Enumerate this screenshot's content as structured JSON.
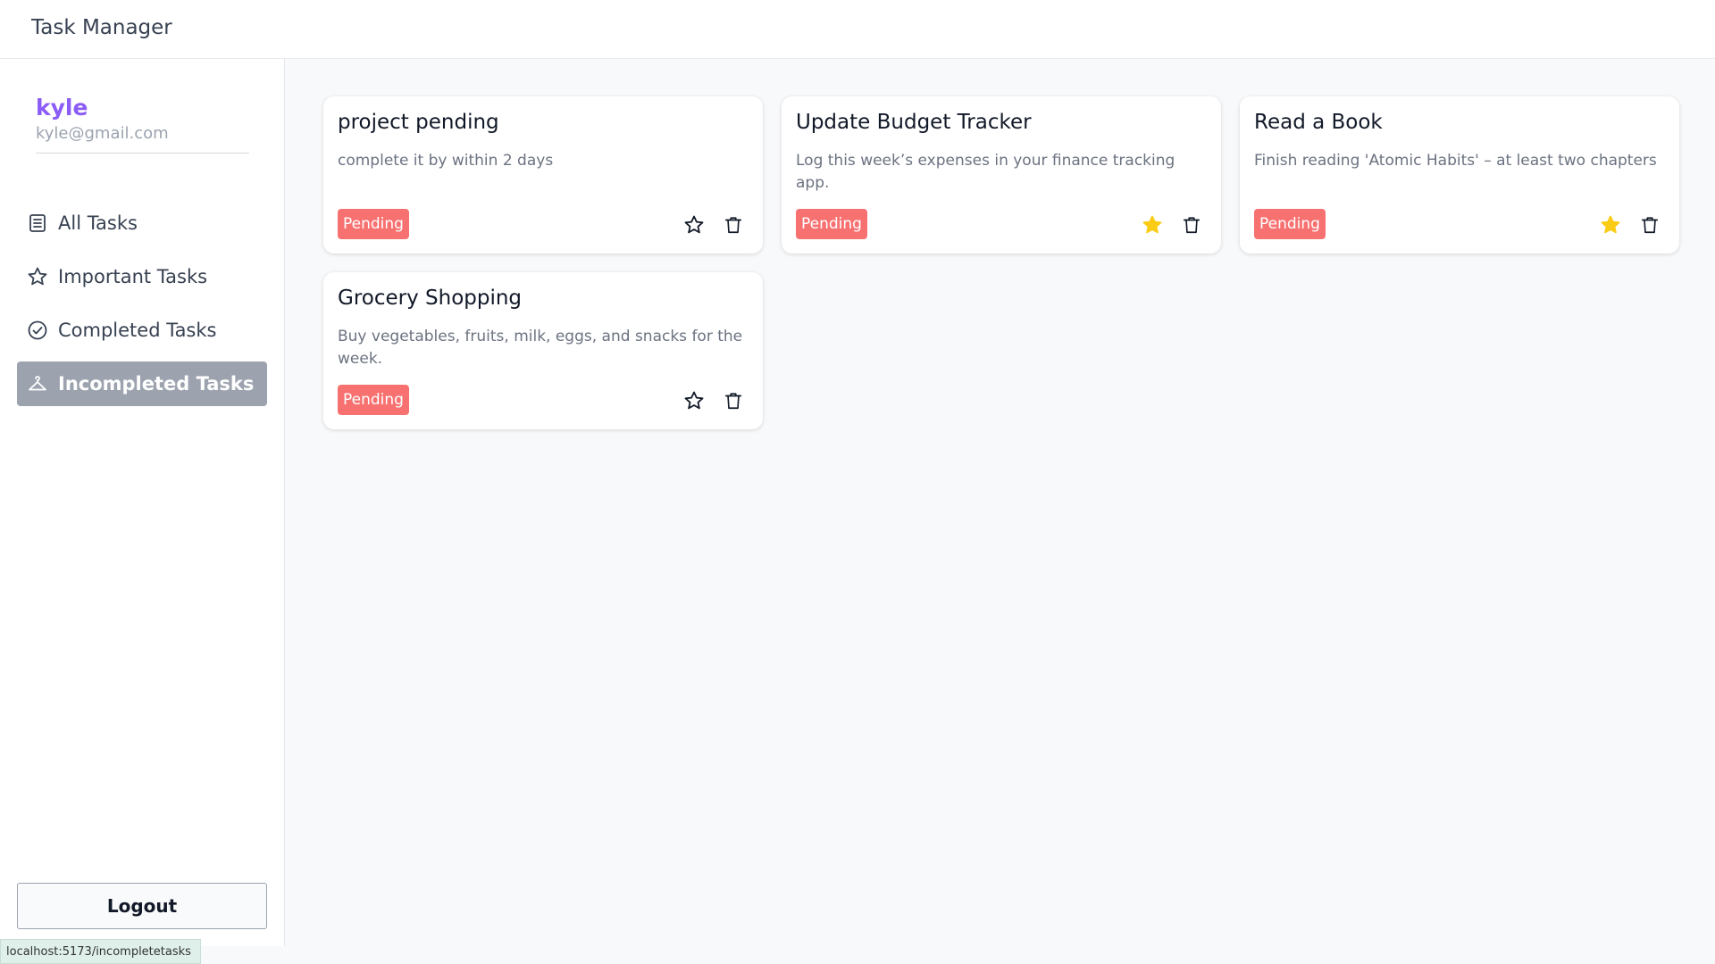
{
  "app": {
    "title": "Task Manager"
  },
  "user": {
    "name": "kyle",
    "email": "kyle@gmail.com"
  },
  "nav": {
    "items": [
      {
        "label": "All Tasks",
        "icon": "list-icon",
        "active": false
      },
      {
        "label": "Important Tasks",
        "icon": "star-icon",
        "active": false
      },
      {
        "label": "Completed Tasks",
        "icon": "check-circle-icon",
        "active": false
      },
      {
        "label": "Incompleted Tasks",
        "icon": "hanger-icon",
        "active": true
      }
    ],
    "logout_label": "Logout"
  },
  "tasks": [
    {
      "title": "project pending",
      "description": "complete it by within 2 days",
      "status": "Pending",
      "important": false
    },
    {
      "title": "Update Budget Tracker",
      "description": "Log this week’s expenses in your finance tracking app.",
      "status": "Pending",
      "important": true
    },
    {
      "title": "Read a Book",
      "description": "Finish reading 'Atomic Habits' – at least two chapters",
      "status": "Pending",
      "important": true
    },
    {
      "title": "Grocery Shopping",
      "description": "Buy vegetables, fruits, milk, eggs, and snacks for the week.",
      "status": "Pending",
      "important": false
    }
  ],
  "statusbar": {
    "url": "localhost:5173/incompletetasks"
  },
  "colors": {
    "accent": "#8b5cf6",
    "active_nav": "#9ca3af",
    "pending_badge": "#f87171",
    "star_filled": "#facc15"
  }
}
